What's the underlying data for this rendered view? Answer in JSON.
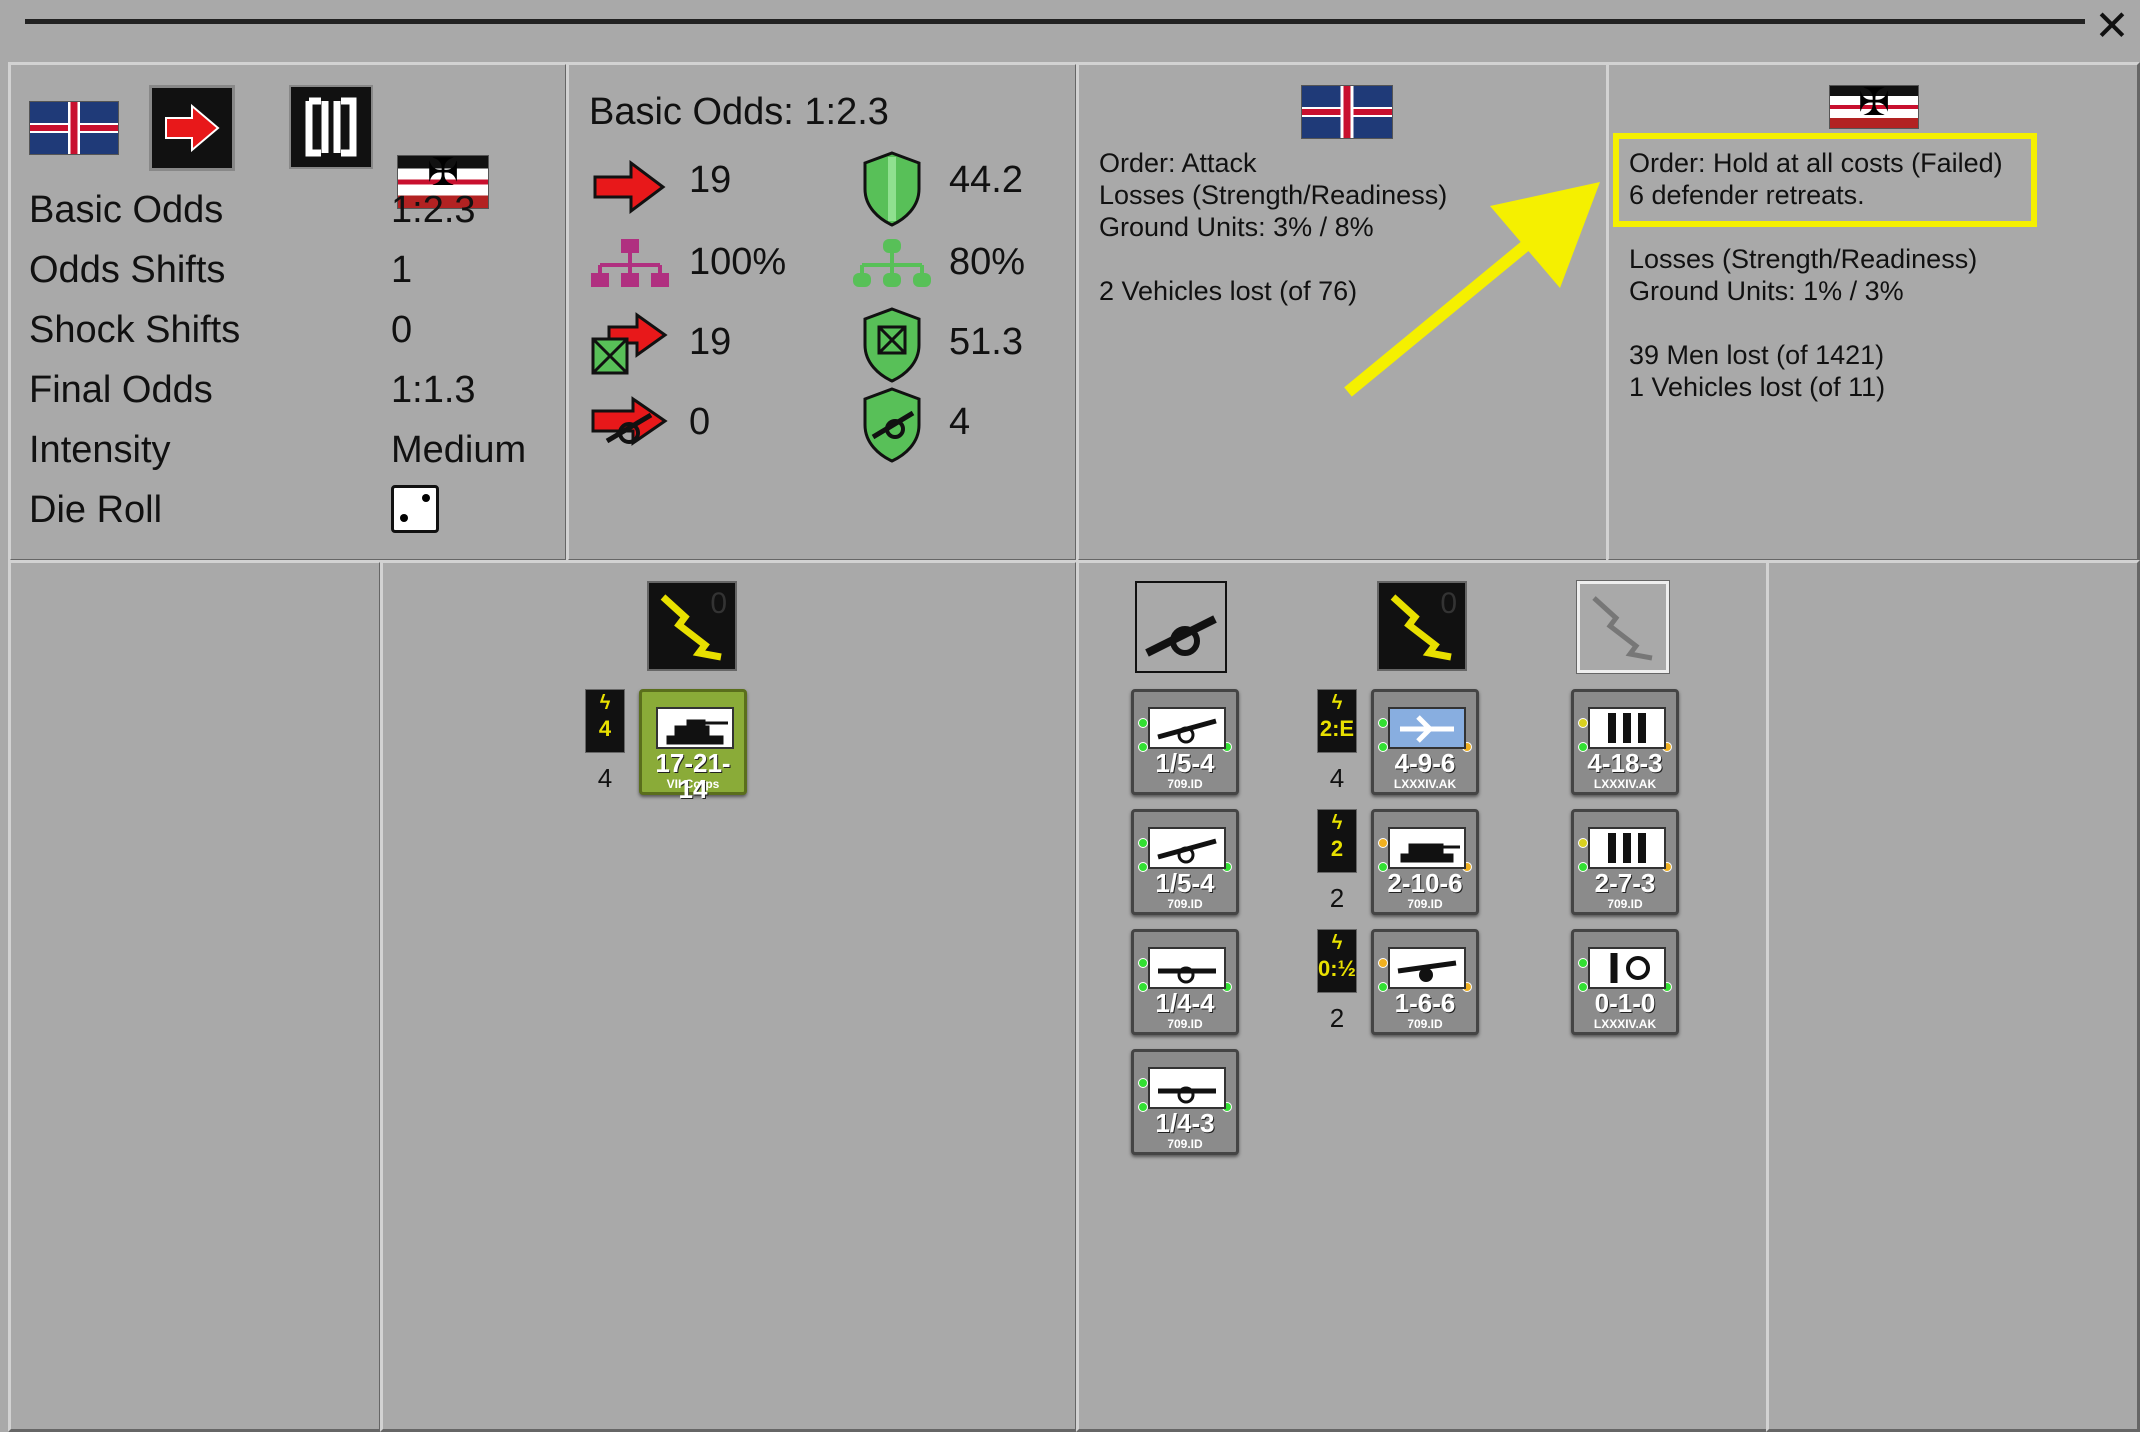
{
  "window": {
    "close_label": "✕"
  },
  "odds_panel": {
    "rows": [
      {
        "label": "Basic Odds",
        "value": "1:2.3"
      },
      {
        "label": "Odds Shifts",
        "value": "1"
      },
      {
        "label": "Shock Shifts",
        "value": "0"
      },
      {
        "label": "Final Odds",
        "value": "1:1.3"
      },
      {
        "label": "Intensity",
        "value": "Medium"
      },
      {
        "label": "Die Roll",
        "value": ""
      }
    ],
    "icons": [
      "flag-gb-icon",
      "attack-arrow-icon",
      "bracket-icon",
      "flag-de-icon",
      "die-icon"
    ]
  },
  "strength_panel": {
    "title": "Basic Odds: 1:2.3",
    "attacker": {
      "strength": "19",
      "hq": "100%",
      "modified": "19",
      "artillery": "0"
    },
    "defender": {
      "strength": "44.2",
      "hq": "80%",
      "modified": "51.3",
      "artillery": "4"
    },
    "colors": {
      "attack": "#e8181a",
      "hq_attack": "#b03080",
      "defend": "#58c058",
      "hq_defend": "#58c058"
    }
  },
  "attacker_result": {
    "lines": [
      "Order: Attack",
      "Losses (Strength/Readiness)",
      "Ground Units: 3% / 8%",
      "",
      "2 Vehicles lost (of 76)"
    ]
  },
  "defender_result": {
    "highlight": [
      "Order: Hold at all costs (Failed)",
      "6 defender retreats."
    ],
    "lines": [
      "Losses (Strength/Readiness)",
      "Ground Units: 1% / 3%",
      "",
      "39 Men lost (of 1421)",
      "1 Vehicles lost (of 11)"
    ],
    "highlight_color": "#f5f000"
  },
  "attacker_units": {
    "shock_icon_value": "0",
    "units": [
      {
        "value": "17-21-14",
        "sub": "VII Corps",
        "yel": "4",
        "count": "4",
        "top_left": "2",
        "top_right": "2"
      }
    ]
  },
  "defender_units": {
    "shock_icon_value": "0",
    "artillery": [
      {
        "value": "1/5-4",
        "sub": "709.ID",
        "top_left": "1",
        "top_right": "1"
      },
      {
        "value": "1/5-4",
        "sub": "709.ID",
        "top_left": "1",
        "top_right": "1"
      },
      {
        "value": "1/4-4",
        "sub": "709.ID",
        "top_left": "1",
        "top_right": "1"
      },
      {
        "value": "1/4-3",
        "sub": "709.ID",
        "top_left": "1",
        "top_right": "1"
      }
    ],
    "shock": [
      {
        "value": "4-9-6",
        "sub": "LXXXIV.AK",
        "yel": "2:E",
        "count": "4",
        "top_left": "8",
        "top_right": "2"
      },
      {
        "value": "2-10-6",
        "sub": "709.ID",
        "yel": "2",
        "count": "2",
        "top_left": "1",
        "top_right": "1"
      },
      {
        "value": "1-6-6",
        "sub": "709.ID",
        "yel": "0:½",
        "count": "2",
        "top_left": "1",
        "top_right": "1"
      }
    ],
    "infantry": [
      {
        "value": "4-18-3",
        "sub": "LXXXIV.AK",
        "top_left": "2",
        "top_right": "2"
      },
      {
        "value": "2-7-3",
        "sub": "709.ID",
        "top_left": "2",
        "top_right": "2"
      },
      {
        "value": "0-1-0",
        "sub": "LXXXIV.AK",
        "top_left": "1",
        "top_right": "1"
      }
    ]
  }
}
